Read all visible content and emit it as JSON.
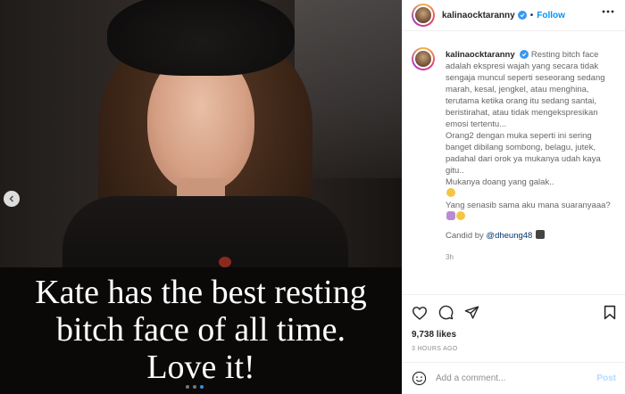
{
  "media": {
    "overlay_lines": [
      "Kate has the best resting",
      "bitch face of all time.",
      "Love it!"
    ],
    "carousel_count": 3,
    "carousel_active_index": 2
  },
  "header": {
    "username": "kalinaocktaranny",
    "separator": "•",
    "follow_label": "Follow"
  },
  "caption": {
    "username": "kalinaocktaranny",
    "paragraph_1": "Resting bitch face adalah ekspresi wajah yang secara tidak sengaja muncul seperti seseorang sedang marah, kesal, jengkel, atau menghina, terutama ketika orang itu sedang santai, beristirahat, atau tidak mengekspresikan emosi tertentu...",
    "paragraph_2": "Orang2 dengan muka seperti ini sering banget dibilang sombong, belagu, jutek, padahal dari orok ya mukanya udah kaya gitu..",
    "paragraph_3": "Mukanya doang yang galak..",
    "paragraph_4": "Yang senasib sama aku mana suaranyaaa?",
    "credit_prefix": "Candid by",
    "credit_mention": "@dheung48",
    "time": "3h"
  },
  "stats": {
    "likes": "9,738 likes",
    "posted": "3 HOURS AGO"
  },
  "comment_box": {
    "placeholder": "Add a comment...",
    "post_label": "Post"
  },
  "colors": {
    "link": "#0095f6",
    "verified": "#3897f0",
    "post_disabled": "#b3dbff",
    "dot_active": "#2b91ef"
  }
}
